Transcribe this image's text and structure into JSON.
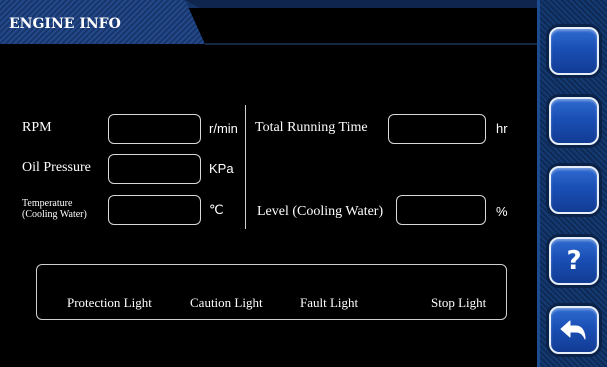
{
  "header": {
    "title": "ENGINE INFO"
  },
  "fields": {
    "rpm": {
      "label": "RPM",
      "value": "",
      "unit": "r/min"
    },
    "oil_pressure": {
      "label": "Oil Pressure",
      "value": "",
      "unit": "KPa"
    },
    "temperature": {
      "label_line1": "Temperature",
      "label_line2": "(Cooling Water)",
      "value": "",
      "unit": "℃"
    },
    "total_running_time": {
      "label": "Total Running Time",
      "value": "",
      "unit": "hr"
    },
    "level": {
      "label": "Level (Cooling Water)",
      "value": "",
      "unit": "%"
    }
  },
  "lights": {
    "protection": "Protection Light",
    "caution": "Caution Light",
    "fault": "Fault Light",
    "stop": "Stop Light"
  },
  "sidebar": {
    "buttons": [
      {
        "label": "",
        "icon": ""
      },
      {
        "label": "",
        "icon": ""
      },
      {
        "label": "",
        "icon": ""
      },
      {
        "label": "?",
        "icon": "help-icon"
      },
      {
        "label": "",
        "icon": "back-arrow-icon"
      }
    ]
  },
  "colors": {
    "background": "#000000",
    "header_band": "#1c3f78",
    "sidebar": "#143a73",
    "button": "#1a4fb5",
    "text": "#ffffff",
    "border": "#d8d8d8"
  }
}
